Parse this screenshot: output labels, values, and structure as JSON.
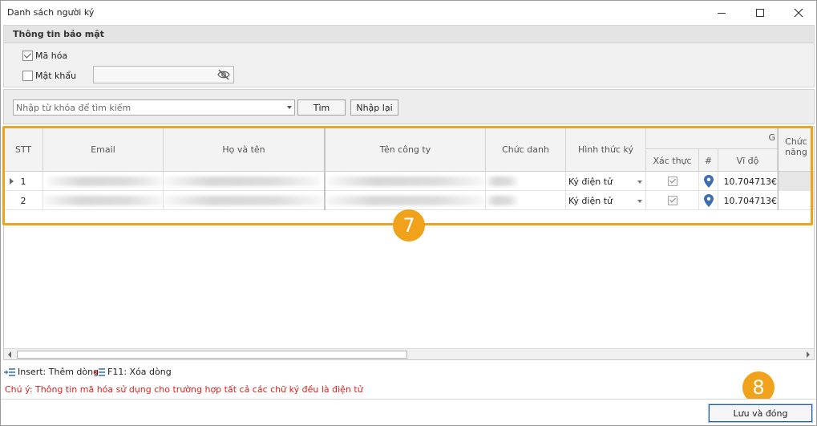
{
  "window": {
    "title": "Danh sách người ký"
  },
  "security": {
    "header": "Thông tin bảo mật",
    "encrypt_label": "Mã hóa",
    "encrypt_checked": true,
    "password_label": "Mật khẩu",
    "password_checked": false,
    "password_value": ""
  },
  "search": {
    "placeholder": "Nhập từ khóa để tìm kiếm",
    "find_label": "Tìm",
    "reset_label": "Nhập lại"
  },
  "grid": {
    "columns": {
      "stt": "STT",
      "email": "Email",
      "fullname": "Họ và tên",
      "company": "Tên công ty",
      "position": "Chức danh",
      "sign_method": "Hình thức ký",
      "group_partial": "G",
      "verify": "Xác thực",
      "hash": "#",
      "latitude": "Vĩ độ",
      "function": "Chức năng"
    },
    "rows": [
      {
        "stt": "1",
        "sign_method": "Ký điện tử",
        "verified": true,
        "latitude": "10.704713€",
        "current": true
      },
      {
        "stt": "2",
        "sign_method": "Ký điện tử",
        "verified": true,
        "latitude": "10.704713€",
        "current": false
      }
    ]
  },
  "annotations": {
    "grid_badge": "7",
    "save_badge": "8",
    "accent_color": "#f0a31a"
  },
  "shortcuts": {
    "insert": "Insert: Thêm dòng",
    "delete": "F11: Xóa dòng"
  },
  "note": "Chú ý: Thông tin mã hóa sử dụng cho trường hợp tất cả các chữ ký đều là điện tử",
  "footer": {
    "save_close_label": "Lưu và đóng"
  }
}
